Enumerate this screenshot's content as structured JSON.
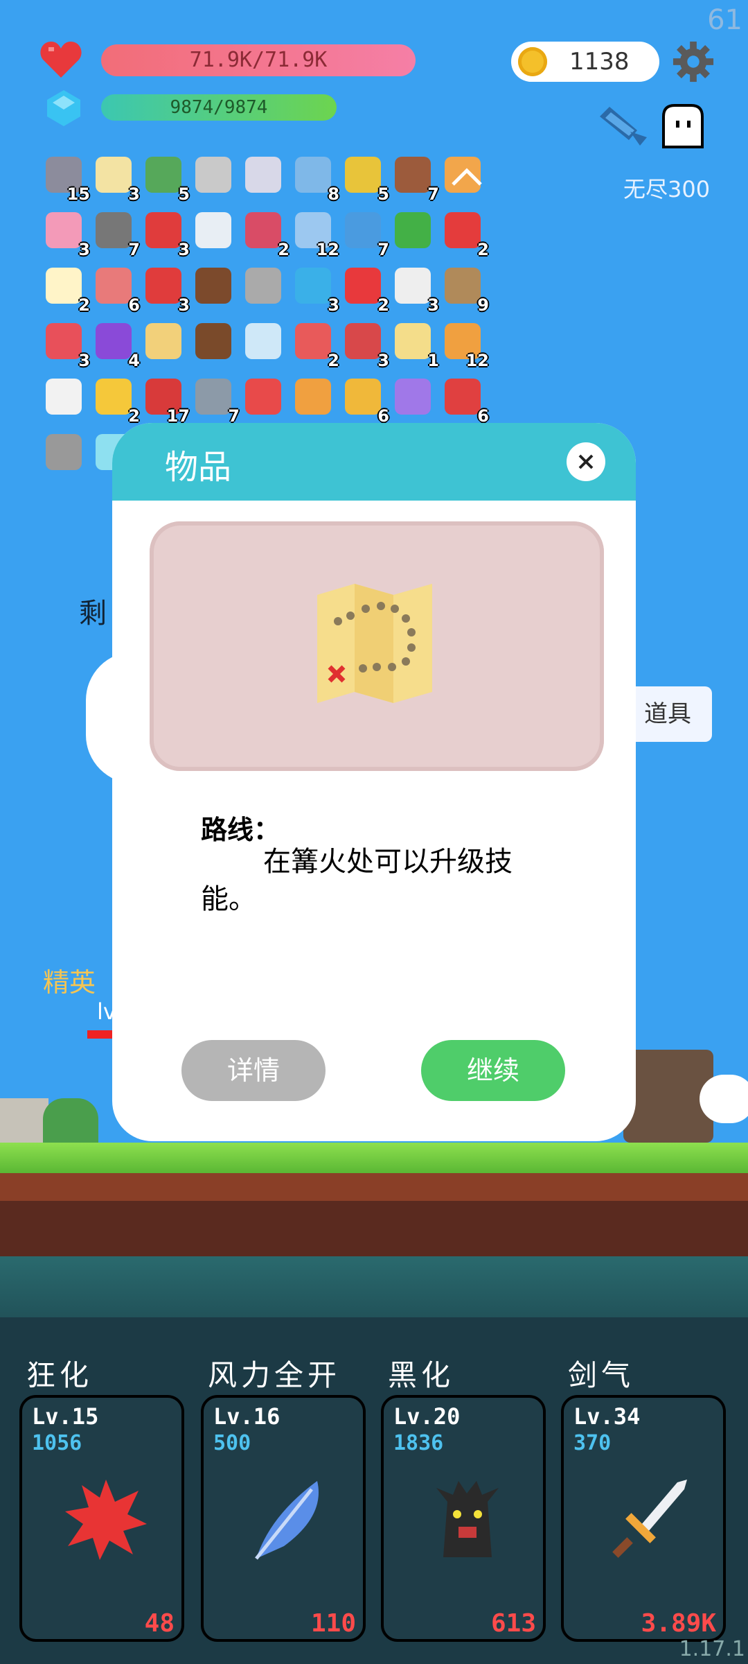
{
  "hud": {
    "fps": "61",
    "hp_text": "71.9K/71.9K",
    "mp_text": "9874/9874",
    "coins": "1138",
    "mode_label": "无尽300"
  },
  "items": [
    {
      "icon": "dagger-icon",
      "count": "15",
      "color": "#8c8c9c"
    },
    {
      "icon": "flower-icon",
      "count": "3",
      "color": "#f3e3a3"
    },
    {
      "icon": "cash-heart-icon",
      "count": "5",
      "color": "#56a85a"
    },
    {
      "icon": "hook-icon",
      "count": "",
      "color": "#c9c9c9"
    },
    {
      "icon": "sword-icon",
      "count": "",
      "color": "#d8d8e8"
    },
    {
      "icon": "shirt-icon",
      "count": "8",
      "color": "#7fb8e8"
    },
    {
      "icon": "pineapple-egg-icon",
      "count": "5",
      "color": "#e8c43a"
    },
    {
      "icon": "door-icon",
      "count": "7",
      "color": "#9c5b3c"
    },
    {
      "icon": "scroll-card-icon",
      "count": "",
      "color": "#f2a64b"
    },
    {
      "icon": "potion-icon",
      "count": "3",
      "color": "#f39ab8"
    },
    {
      "icon": "spiked-ball-icon",
      "count": "7",
      "color": "#777"
    },
    {
      "icon": "strawberry-icon",
      "count": "3",
      "color": "#e03c3c"
    },
    {
      "icon": "cloud-icon",
      "count": "",
      "color": "#e8eef4"
    },
    {
      "icon": "jam-jar-icon",
      "count": "2",
      "color": "#d94c66"
    },
    {
      "icon": "sparkle-icon",
      "count": "12",
      "color": "#9cc8f0"
    },
    {
      "icon": "star-card-icon",
      "count": "7",
      "color": "#4a9be0"
    },
    {
      "icon": "biohazard-icon",
      "count": "",
      "color": "#43b046"
    },
    {
      "icon": "percent-card-icon",
      "count": "2",
      "color": "#e43c3c"
    },
    {
      "icon": "egg-icon",
      "count": "2",
      "color": "#fff4c8"
    },
    {
      "icon": "meat-icon",
      "count": "6",
      "color": "#e87a7a"
    },
    {
      "icon": "sock-icon",
      "count": "3",
      "color": "#e03c3c"
    },
    {
      "icon": "mushroom-brown-icon",
      "count": "",
      "color": "#7c4a2c"
    },
    {
      "icon": "viking-helmet-icon",
      "count": "",
      "color": "#aaa"
    },
    {
      "icon": "chat-bubble-icon",
      "count": "3",
      "color": "#3ab0e8"
    },
    {
      "icon": "heart-item-icon",
      "count": "2",
      "color": "#e8393c"
    },
    {
      "icon": "cards-icon",
      "count": "3",
      "color": "#eee"
    },
    {
      "icon": "noose-icon",
      "count": "9",
      "color": "#b08a5a"
    },
    {
      "icon": "watermelon-icon",
      "count": "3",
      "color": "#e8505a"
    },
    {
      "icon": "crystal-ball-icon",
      "count": "4",
      "color": "#8a4ad8"
    },
    {
      "icon": "scroll-icon",
      "count": "",
      "color": "#f2d07a"
    },
    {
      "icon": "coconut-icon",
      "count": "",
      "color": "#7a4a2a"
    },
    {
      "icon": "flask-icon",
      "count": "",
      "color": "#cfe8f8"
    },
    {
      "icon": "pill-icon",
      "count": "2",
      "color": "#e85a5a"
    },
    {
      "icon": "shield-icon",
      "count": "3",
      "color": "#d8484a"
    },
    {
      "icon": "map-item-icon",
      "count": "1",
      "color": "#f4dd8a"
    },
    {
      "icon": "bag-icon",
      "count": "12",
      "color": "#f0a040"
    },
    {
      "icon": "envelope-icon",
      "count": "",
      "color": "#f2f2f2"
    },
    {
      "icon": "sun-icon",
      "count": "2",
      "color": "#f5c83a"
    },
    {
      "icon": "target-icon",
      "count": "17",
      "color": "#d83a3a"
    },
    {
      "icon": "axe-icon",
      "count": "7",
      "color": "#8c9aa8"
    },
    {
      "icon": "hearts-icon",
      "count": "",
      "color": "#e84a4a"
    },
    {
      "icon": "boot-icon",
      "count": "",
      "color": "#f0a040"
    },
    {
      "icon": "pineapple-icon",
      "count": "6",
      "color": "#f0b83a"
    },
    {
      "icon": "purple-gem-icon",
      "count": "",
      "color": "#a078e8"
    },
    {
      "icon": "mushroom-red-icon",
      "count": "6",
      "color": "#e04040"
    },
    {
      "icon": "silver-orb-icon",
      "count": "",
      "color": "#999"
    },
    {
      "icon": "lightbulb-icon",
      "count": "",
      "color": "#8ee0f0"
    }
  ],
  "side_label": "剩",
  "side_button": "道具",
  "enemy": {
    "tag": "精英",
    "level": "lv"
  },
  "modal": {
    "title": "物品",
    "item_name": "路线：",
    "item_desc": "在篝火处可以升级技能。",
    "detail_btn": "详情",
    "continue_btn": "继续"
  },
  "skills": [
    {
      "name": "狂化",
      "level": "Lv.15",
      "value": "1056",
      "cost": "48",
      "icon": "red-splat-icon"
    },
    {
      "name": "风力全开",
      "level": "Lv.16",
      "value": "500",
      "cost": "110",
      "icon": "blue-feather-icon"
    },
    {
      "name": "黑化",
      "level": "Lv.20",
      "value": "1836",
      "cost": "613",
      "icon": "dark-tree-monster-icon"
    },
    {
      "name": "剑气",
      "level": "Lv.34",
      "value": "370",
      "cost": "3.89K",
      "icon": "sword-skill-icon"
    }
  ],
  "version": "1.17.1",
  "colors": {
    "sky": "#3aa1f1",
    "modal_header": "#3ec3d3",
    "continue": "#4fcd6a",
    "detail": "#b5b5b5",
    "cost": "#ff4b4b",
    "skill_value": "#4ec2ef"
  }
}
